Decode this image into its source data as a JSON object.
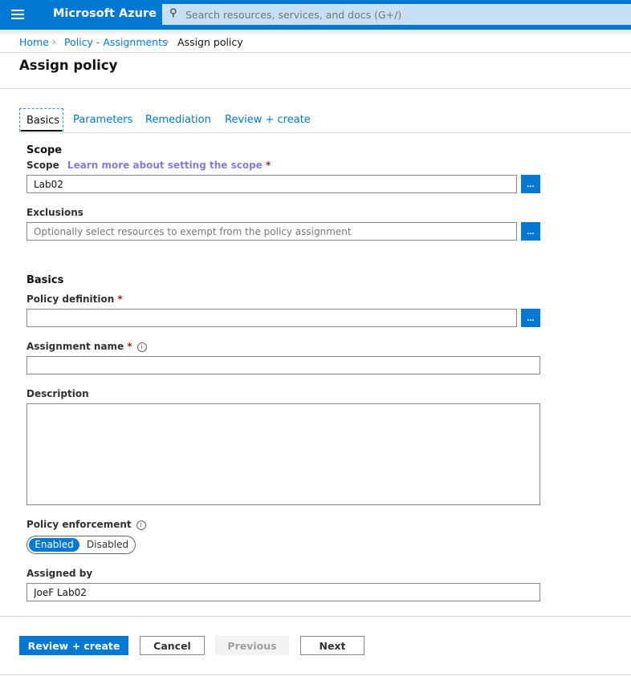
{
  "header": {
    "brand": "Microsoft Azure",
    "search_placeholder": "Search resources, services, and docs (G+/)"
  },
  "breadcrumb": [
    "Home",
    "Policy - Assignments",
    "Assign policy"
  ],
  "page_title": "Assign policy",
  "tabs": [
    "Basics",
    "Parameters",
    "Remediation",
    "Review + create"
  ],
  "scope": {
    "section": "Scope",
    "label": "Scope",
    "link": "Learn more about setting the scope",
    "value": "Lab02",
    "exclusions_label": "Exclusions",
    "exclusions_placeholder": "Optionally select resources to exempt from the policy assignment"
  },
  "basics": {
    "section": "Basics",
    "policy_definition_label": "Policy definition",
    "policy_definition_value": "",
    "assignment_name_label": "Assignment name",
    "assignment_name_value": "",
    "description_label": "Description",
    "description_value": "",
    "enforcement_label": "Policy enforcement",
    "enforcement_options": [
      "Enabled",
      "Disabled"
    ],
    "enforcement_selected": "Enabled",
    "assigned_by_label": "Assigned by",
    "assigned_by_value": "JoeF Lab02"
  },
  "browse_label": "...",
  "required_mark": "*",
  "info_glyph": "i",
  "footer": {
    "review": "Review + create",
    "cancel": "Cancel",
    "previous": "Previous",
    "next": "Next"
  },
  "colors": {
    "accent": "#0078d4",
    "required": "#a4262c",
    "link_purple": "#8a7ad8"
  }
}
